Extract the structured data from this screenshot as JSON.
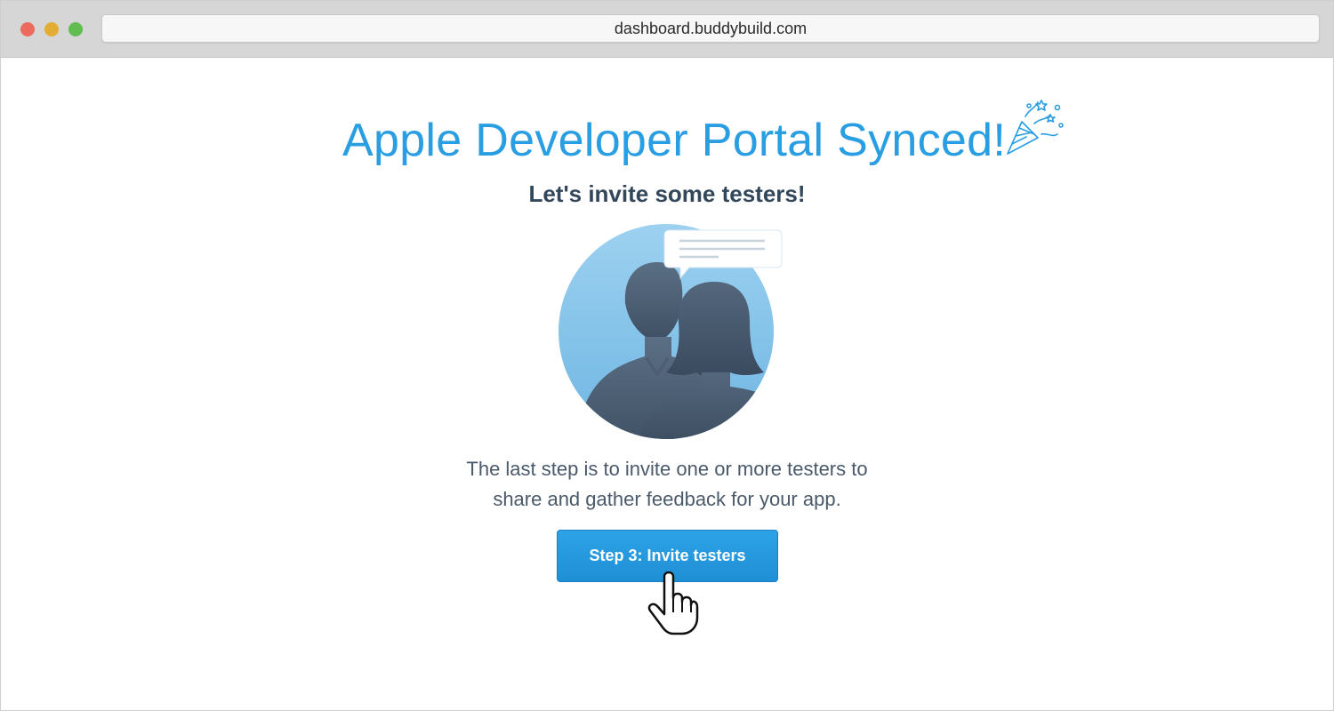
{
  "browser": {
    "url": "dashboard.buddybuild.com"
  },
  "main": {
    "title": "Apple Developer Portal Synced!",
    "subtitle": "Let's invite some testers!",
    "description_line1": "The last step is to invite one or more testers to",
    "description_line2": "share and gather feedback for your app.",
    "cta_label": "Step 3: Invite testers"
  },
  "icons": {
    "party": "party-popper-icon",
    "illustration": "testers-avatar-illustration",
    "cursor": "hand-pointer-cursor-icon"
  },
  "colors": {
    "accent": "#2a9ee2",
    "button": "#1f8fd6",
    "heading_dark": "#33475b",
    "body_text": "#4a5a6b"
  }
}
